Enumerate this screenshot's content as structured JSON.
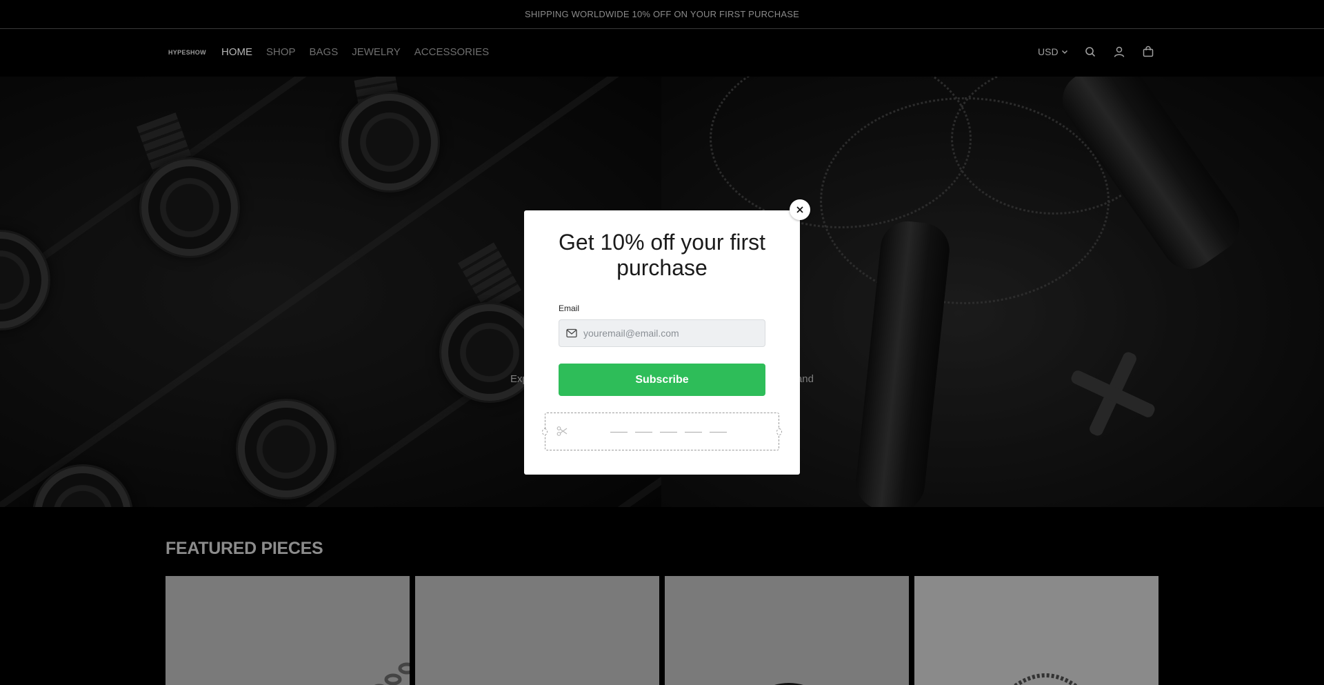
{
  "announcement": "SHIPPING WORLDWIDE 10% OFF ON YOUR FIRST PURCHASE",
  "header": {
    "logo": "HYPESHOW",
    "nav": [
      "HOME",
      "SHOP",
      "BAGS",
      "JEWELRY",
      "ACCESSORIES"
    ],
    "active_nav": "HOME",
    "currency": "USD",
    "icons": [
      "search-icon",
      "account-icon",
      "cart-icon"
    ]
  },
  "hero": {
    "text_left": "Exp",
    "text_right": "and"
  },
  "featured": {
    "title": "FEATURED PIECES"
  },
  "popup": {
    "title": "Get 10% off your first purchase",
    "email_label": "Email",
    "email_placeholder": "youremail@email.com",
    "email_value": "",
    "subscribe_label": "Subscribe",
    "close_icon": "close-icon",
    "coupon_icon": "scissors-icon",
    "colors": {
      "subscribe": "#2ebd59",
      "modal_bg": "#ffffff"
    }
  }
}
